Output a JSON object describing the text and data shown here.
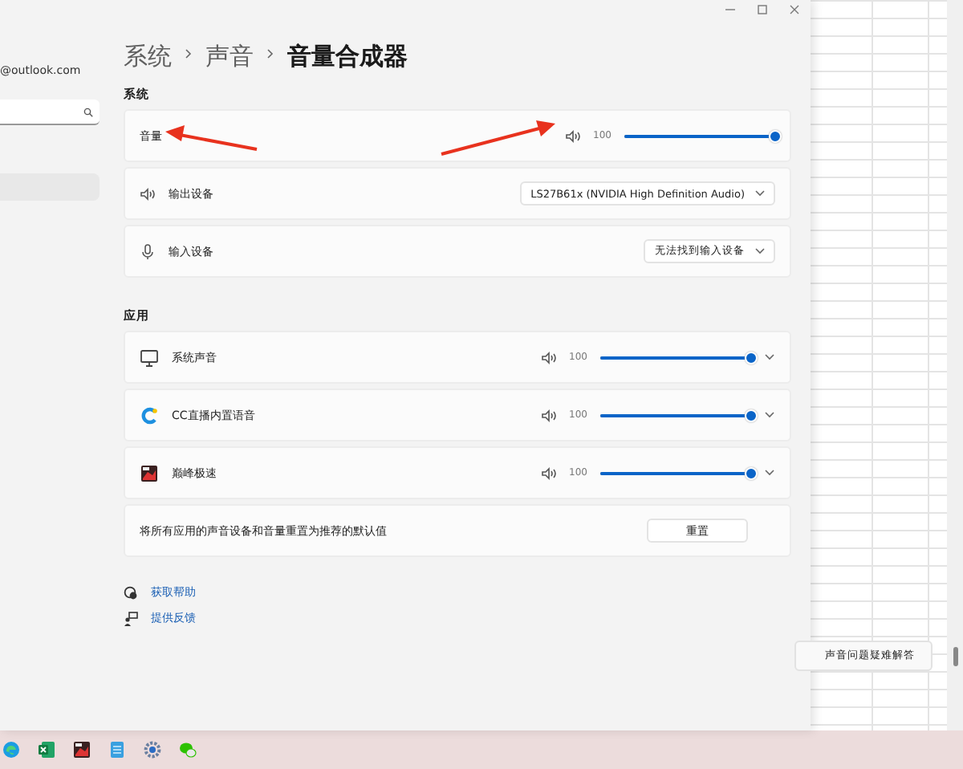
{
  "account": {
    "email": "@outlook.com"
  },
  "breadcrumb": [
    {
      "text": "系统",
      "current": false
    },
    {
      "text": "声音",
      "current": false
    },
    {
      "text": "音量合成器",
      "current": true
    }
  ],
  "system": {
    "label": "系统",
    "volume": {
      "label": "音量",
      "reading": "100",
      "level": 1
    },
    "output": {
      "label": "输出设备",
      "value": "LS27B61x (NVIDIA High Definition Audio)"
    },
    "input": {
      "label": "输入设备",
      "value": "无法找到输入设备"
    }
  },
  "apps": {
    "label": "应用",
    "items": [
      {
        "name": "系统声音",
        "reading": "100",
        "level": 1
      },
      {
        "name": "CC直播内置语音",
        "reading": "100",
        "level": 1
      },
      {
        "name": "巅峰极速",
        "reading": "100",
        "level": 1
      }
    ],
    "reset": {
      "text": "将所有应用的声音设备和音量重置为推荐的默认值",
      "button": "重置"
    }
  },
  "links": [
    {
      "text": "获取帮助"
    },
    {
      "text": "提供反馈"
    }
  ],
  "tooltip": "声音问题疑难解答"
}
